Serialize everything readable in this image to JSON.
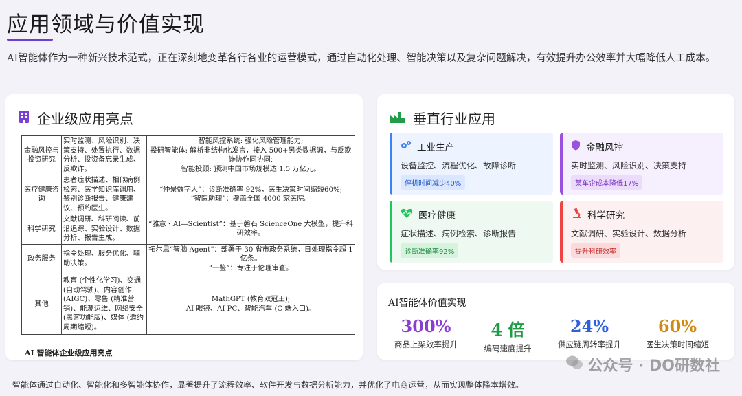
{
  "header": {
    "title": "应用领域与价值实现",
    "intro": "AI智能体作为一种新兴技术范式，正在深刻地变革各行各业的运营模式，通过自动化处理、智能决策以及复杂问题解决，有效提升办公效率并大幅降低人工成本。"
  },
  "enterprise": {
    "title": "企业级应用亮点",
    "icon": "building-icon",
    "caption": "AI 智能体企业级应用亮点",
    "rows": [
      {
        "field": "金融风控与投资研究",
        "tasks": "实时监测、风险识别、决策支持、处置执行、数据分析、投资备忘录生成、反欺诈。",
        "case": "智能风控系统: 强化风险管理能力;\n投研智能体: 解析非结构化发言，接入 500+另类数据源，与反欺诈协作同协同;\n智能投顾: 预测中国市场规模达 1.5 万亿元。"
      },
      {
        "field": "医疗健康咨询",
        "tasks": "患者症状描述、相似病例检索、医学知识库调用、鉴别诊断报告、健康建议、预约医生。",
        "case": "“仲景数字人”：诊断准确率 92%，医生决策时间缩短60%;\n“智医助理”：覆盖全国 4000 家医院。"
      },
      {
        "field": "科学研究",
        "tasks": "文献调研、科研阅读、前沿追踪、实验设计、数据分析、报告生成。",
        "case": "“雅意・AI—Scientist”：基于磐石 ScienceOne 大模型，提升科研效率。"
      },
      {
        "field": "政务服务",
        "tasks": "指令处理、服务优化、辅助决策。",
        "case": "拓尔思“智脑 Agent”：部署于 30 省市政务系统，日处理指令超 1 亿条。\n“一鉴”：专注于伦理审查。"
      },
      {
        "field": "其他",
        "tasks": "教育 (个性化学习)、交通 (自动驾驶)、内容创作 (AIGC)、零售 (精准营销)、能源运维、网络安全 (黑客功能版)、媒体 (邀约周期缩短)。",
        "case": "MathGPT (教育双冠王);\nAI 眼镜、AI PC、智能汽车 (C 端入口)。"
      }
    ]
  },
  "vertical": {
    "title": "垂直行业应用",
    "icon": "factory-icon",
    "cards": [
      {
        "title": "工业生产",
        "icon": "gears-icon",
        "desc": "设备监控、流程优化、故障诊断",
        "tag": "停机时间减少40%",
        "bg": "#eef4ff",
        "border": "#3b82f6",
        "tagbg": "#dbe7ff",
        "tagcolor": "#2459c9"
      },
      {
        "title": "金融风控",
        "icon": "shield-icon",
        "desc": "实时监测、风险识别、决策支持",
        "tag": "某车企成本降低17%",
        "bg": "#f6effd",
        "border": "#9b51e0",
        "tagbg": "#ecdcfb",
        "tagcolor": "#7b2fc2"
      },
      {
        "title": "医疗健康",
        "icon": "heart-pulse-icon",
        "desc": "症状描述、病例检索、诊断报告",
        "tag": "诊断准确率92%",
        "bg": "#eefaf1",
        "border": "#22c55e",
        "tagbg": "#d6f3dd",
        "tagcolor": "#1e8a43"
      },
      {
        "title": "科学研究",
        "icon": "microscope-icon",
        "desc": "文献调研、实验设计、数据分析",
        "tag": "提升科研效率",
        "bg": "#fdf0f0",
        "border": "#ef4444",
        "tagbg": "#fadada",
        "tagcolor": "#c42a2a"
      }
    ]
  },
  "metrics": {
    "title": "AI智能体价值实现",
    "items": [
      {
        "value": "300%",
        "label": "商品上架效率提升",
        "color": "#8a3fd1"
      },
      {
        "value": "4 倍",
        "label": "编码速度提升",
        "color": "#1e9c45"
      },
      {
        "value": "24%",
        "label": "供应链周转率提升",
        "color": "#2f62d8"
      },
      {
        "value": "60%",
        "label": "医生决策时间缩短",
        "color": "#d08a12"
      }
    ]
  },
  "footer": {
    "text": "智能体通过自动化、智能化和多智能体协作，显著提升了流程效率、软件开发与数据分析能力，并优化了电商运营，从而实现整体降本增效。"
  },
  "watermark": {
    "text": "公众号 · DO研数社"
  }
}
